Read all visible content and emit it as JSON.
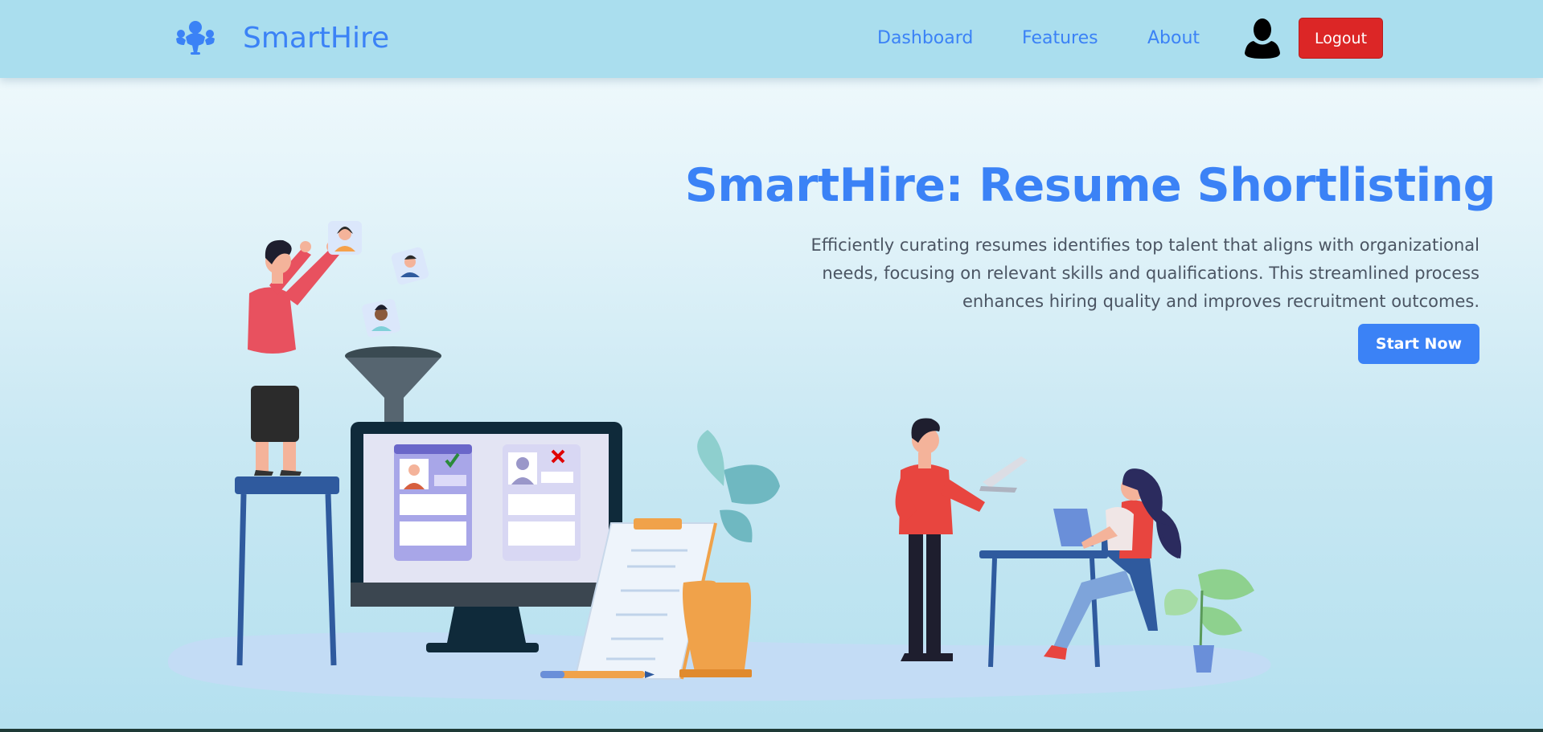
{
  "navbar": {
    "brand": "SmartHire",
    "links": {
      "dashboard": "Dashboard",
      "features": "Features",
      "about": "About"
    },
    "logout_label": "Logout",
    "icons": {
      "logo": "people-network-icon",
      "avatar": "user-avatar-icon"
    }
  },
  "hero": {
    "title": "SmartHire: Resume Shortlisting",
    "description": "Efficiently curating resumes identifies top talent that aligns with organizational needs, focusing on relevant skills and qualifications. This streamlined process enhances hiring quality and improves recruitment outcomes.",
    "cta_label": "Start Now",
    "illustration": "resume-shortlisting-illustration"
  },
  "colors": {
    "navbar_bg": "#aadeee",
    "brand": "#3b82f6",
    "logout": "#dc2626",
    "cta": "#3b82f6",
    "text": "#4b5563"
  }
}
